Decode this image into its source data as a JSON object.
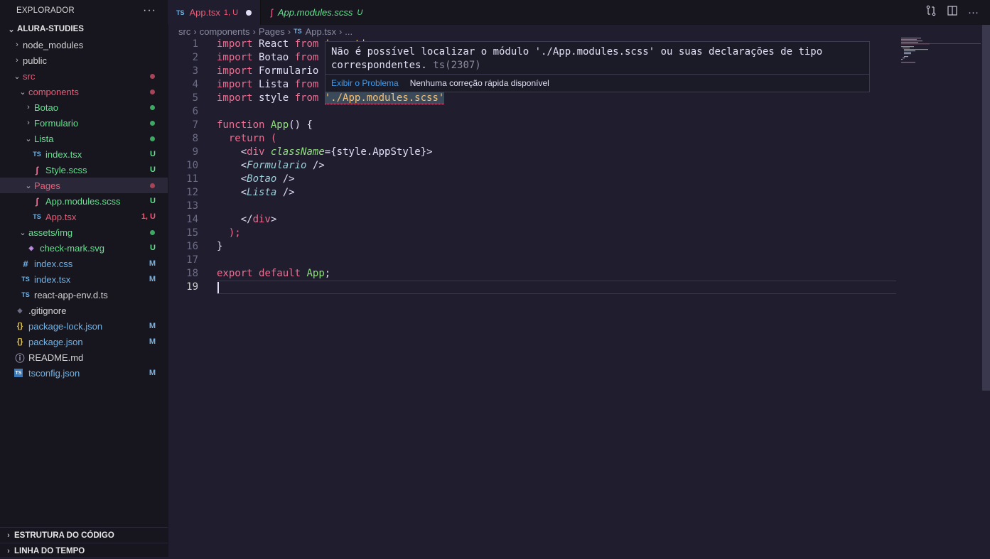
{
  "sidebar": {
    "title": "EXPLORADOR",
    "more": "···",
    "root": "ALURA-STUDIES",
    "tree": [
      {
        "label": "node_modules",
        "indent": 0,
        "chev": "›",
        "icon": "",
        "iconName": "",
        "color": "plain",
        "status": "",
        "statusColor": ""
      },
      {
        "label": "public",
        "indent": 0,
        "chev": "›",
        "icon": "",
        "iconName": "",
        "color": "plain",
        "status": "",
        "statusColor": ""
      },
      {
        "label": "src",
        "indent": 0,
        "chev": "⌄",
        "icon": "",
        "iconName": "",
        "color": "red",
        "status": "dot",
        "statusColor": "red"
      },
      {
        "label": "components",
        "indent": 1,
        "chev": "⌄",
        "icon": "",
        "iconName": "",
        "color": "red",
        "status": "dot",
        "statusColor": "red"
      },
      {
        "label": "Botao",
        "indent": 2,
        "chev": "›",
        "icon": "",
        "iconName": "",
        "color": "green",
        "status": "dot",
        "statusColor": "green"
      },
      {
        "label": "Formulario",
        "indent": 2,
        "chev": "›",
        "icon": "",
        "iconName": "",
        "color": "green",
        "status": "dot",
        "statusColor": "green"
      },
      {
        "label": "Lista",
        "indent": 2,
        "chev": "⌄",
        "icon": "",
        "iconName": "",
        "color": "green",
        "status": "dot",
        "statusColor": "green"
      },
      {
        "label": "index.tsx",
        "indent": 3,
        "chev": "",
        "icon": "TS",
        "iconName": "typescript-icon",
        "color": "green",
        "status": "U",
        "statusColor": "green"
      },
      {
        "label": "Style.scss",
        "indent": 3,
        "chev": "",
        "icon": "ʃ",
        "iconName": "sass-icon",
        "color": "green",
        "status": "U",
        "statusColor": "green"
      },
      {
        "label": "Pages",
        "indent": 2,
        "chev": "⌄",
        "icon": "",
        "iconName": "",
        "color": "red",
        "status": "dot",
        "statusColor": "red",
        "selected": true
      },
      {
        "label": "App.modules.scss",
        "indent": 3,
        "chev": "",
        "icon": "ʃ",
        "iconName": "sass-icon",
        "color": "green",
        "status": "U",
        "statusColor": "green"
      },
      {
        "label": "App.tsx",
        "indent": 3,
        "chev": "",
        "icon": "TS",
        "iconName": "typescript-icon",
        "color": "red",
        "status": "1, U",
        "statusColor": "red"
      },
      {
        "label": "assets/img",
        "indent": 1,
        "chev": "⌄",
        "icon": "",
        "iconName": "",
        "color": "green",
        "status": "dot",
        "statusColor": "green"
      },
      {
        "label": "check-mark.svg",
        "indent": 2,
        "chev": "",
        "icon": "◈",
        "iconName": "svg-icon",
        "color": "green",
        "status": "U",
        "statusColor": "green"
      },
      {
        "label": "index.css",
        "indent": 1,
        "chev": "",
        "icon": "#",
        "iconName": "css-icon",
        "color": "blue",
        "status": "M",
        "statusColor": "blue"
      },
      {
        "label": "index.tsx",
        "indent": 1,
        "chev": "",
        "icon": "TS",
        "iconName": "typescript-icon",
        "color": "blue",
        "status": "M",
        "statusColor": "blue"
      },
      {
        "label": "react-app-env.d.ts",
        "indent": 1,
        "chev": "",
        "icon": "TS",
        "iconName": "typescript-icon",
        "color": "plain",
        "status": "",
        "statusColor": ""
      },
      {
        "label": ".gitignore",
        "indent": 0,
        "chev": "",
        "icon": "◆",
        "iconName": "git-icon",
        "color": "plain",
        "status": "",
        "statusColor": ""
      },
      {
        "label": "package-lock.json",
        "indent": 0,
        "chev": "",
        "icon": "{}",
        "iconName": "json-icon",
        "color": "blue",
        "status": "M",
        "statusColor": "blue"
      },
      {
        "label": "package.json",
        "indent": 0,
        "chev": "",
        "icon": "{}",
        "iconName": "json-icon",
        "color": "blue",
        "status": "M",
        "statusColor": "blue"
      },
      {
        "label": "README.md",
        "indent": 0,
        "chev": "",
        "icon": "ⓘ",
        "iconName": "info-icon",
        "color": "plain",
        "status": "",
        "statusColor": ""
      },
      {
        "label": "tsconfig.json",
        "indent": 0,
        "chev": "",
        "icon": "TS",
        "iconName": "tsconfig-icon",
        "color": "blue",
        "status": "M",
        "statusColor": "blue"
      }
    ],
    "outline": "ESTRUTURA DO CÓDIGO",
    "timeline": "LINHA DO TEMPO"
  },
  "tabs": [
    {
      "icon": "TS",
      "label": "App.tsx",
      "badge": "1, U",
      "active": true
    },
    {
      "icon": "ʃ",
      "label": "App.modules.scss",
      "badge": "U",
      "active": false
    }
  ],
  "breadcrumbs": [
    "src",
    "components",
    "Pages",
    "App.tsx",
    "..."
  ],
  "breadcrumb_ts_icon": "TS",
  "hover": {
    "message": "Não é possível localizar o módulo './App.modules.scss' ou suas declarações de tipo correspondentes.",
    "code": "ts(2307)",
    "link": "Exibir o Problema",
    "note": "Nenhuma correção rápida disponível"
  },
  "editor": {
    "current_line": 19,
    "lines": [
      "import React from 'react';",
      "import Botao from",
      "import Formulario",
      "import Lista from",
      "import style from './App.modules.scss'",
      "",
      "function App() {",
      "  return (",
      "    <div className={style.AppStyle}>",
      "    <Formulario />",
      "    <Botao />",
      "    <Lista />",
      "",
      "    </div>",
      "  );",
      "}",
      "",
      "export default App;",
      ""
    ]
  },
  "colors": {
    "editor_bg": "#1f1d2e",
    "sidebar_bg": "#17161f",
    "keyword": "#eb6f92",
    "function": "#8ee07a",
    "string": "#f6c177",
    "component": "#9ccfd8",
    "untracked": "#5fe38b",
    "error": "#f05a74",
    "modified": "#6fb4e8"
  }
}
